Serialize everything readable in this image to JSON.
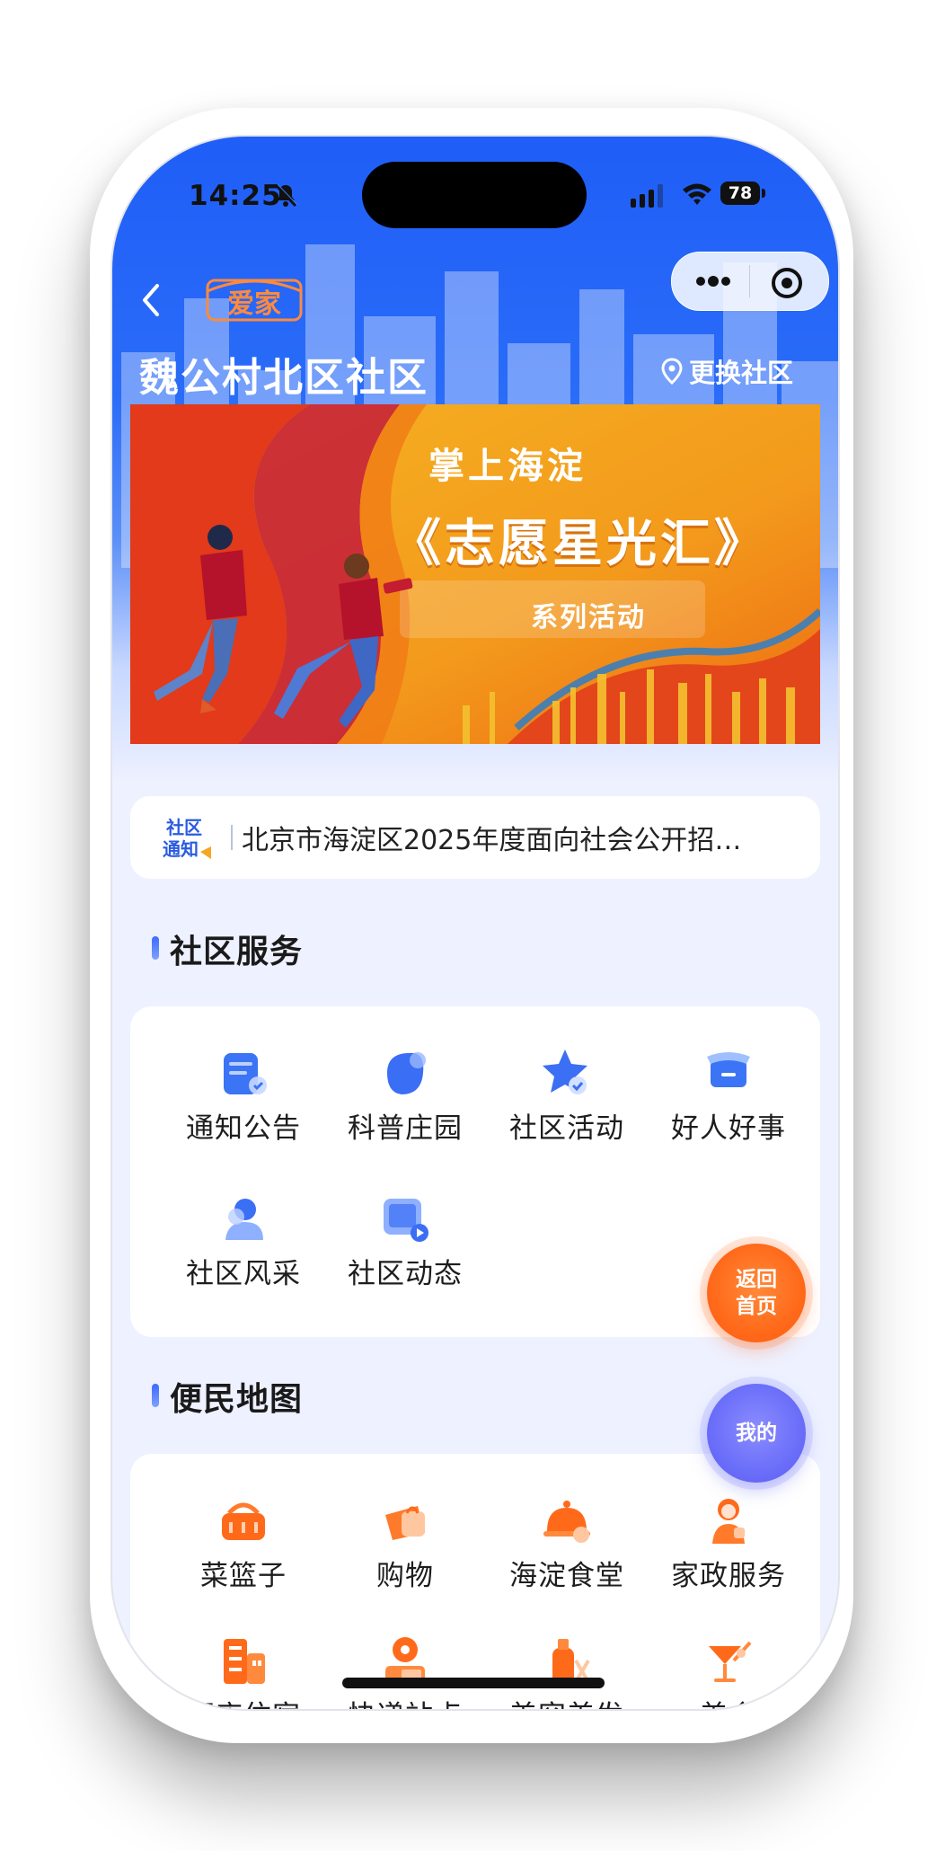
{
  "status_bar": {
    "time": "14:25",
    "battery": "78"
  },
  "header": {
    "logo_text": "爱家",
    "community_name": "魏公村北区社区",
    "change_community": "更换社区"
  },
  "banner": {
    "line1": "掌上海淀",
    "line2": "《志愿星光汇》",
    "line3": "系列活动"
  },
  "notice": {
    "icon_text_top": "社区",
    "icon_text_bottom": "通知",
    "text": "北京市海淀区2025年度面向社会公开招…"
  },
  "community_services": {
    "title": "社区服务",
    "items": [
      {
        "label": "通知公告",
        "icon": "notice-board-icon"
      },
      {
        "label": "科普庄园",
        "icon": "science-leaf-icon"
      },
      {
        "label": "社区活动",
        "icon": "star-activity-icon"
      },
      {
        "label": "好人好事",
        "icon": "good-deeds-icon"
      },
      {
        "label": "社区风采",
        "icon": "community-style-icon"
      },
      {
        "label": "社区动态",
        "icon": "community-news-icon"
      }
    ]
  },
  "convenience_map": {
    "title": "便民地图",
    "items": [
      {
        "label": "菜篮子",
        "icon": "basket-icon"
      },
      {
        "label": "购物",
        "icon": "shopping-bag-icon"
      },
      {
        "label": "海淀食堂",
        "icon": "canteen-icon"
      },
      {
        "label": "家政服务",
        "icon": "housekeeping-icon"
      },
      {
        "label": "酒店住宿",
        "icon": "hotel-icon"
      },
      {
        "label": "快递站点",
        "icon": "express-station-icon"
      },
      {
        "label": "美容美发",
        "icon": "beauty-salon-icon"
      },
      {
        "label": "美食",
        "icon": "food-cocktail-icon"
      }
    ]
  },
  "float_buttons": {
    "home_line1": "返回",
    "home_line2": "首页",
    "mine": "我的"
  },
  "colors": {
    "primary_blue": "#2a6cf8",
    "accent_orange": "#ff6a1a",
    "accent_purple": "#6b6ef9"
  }
}
